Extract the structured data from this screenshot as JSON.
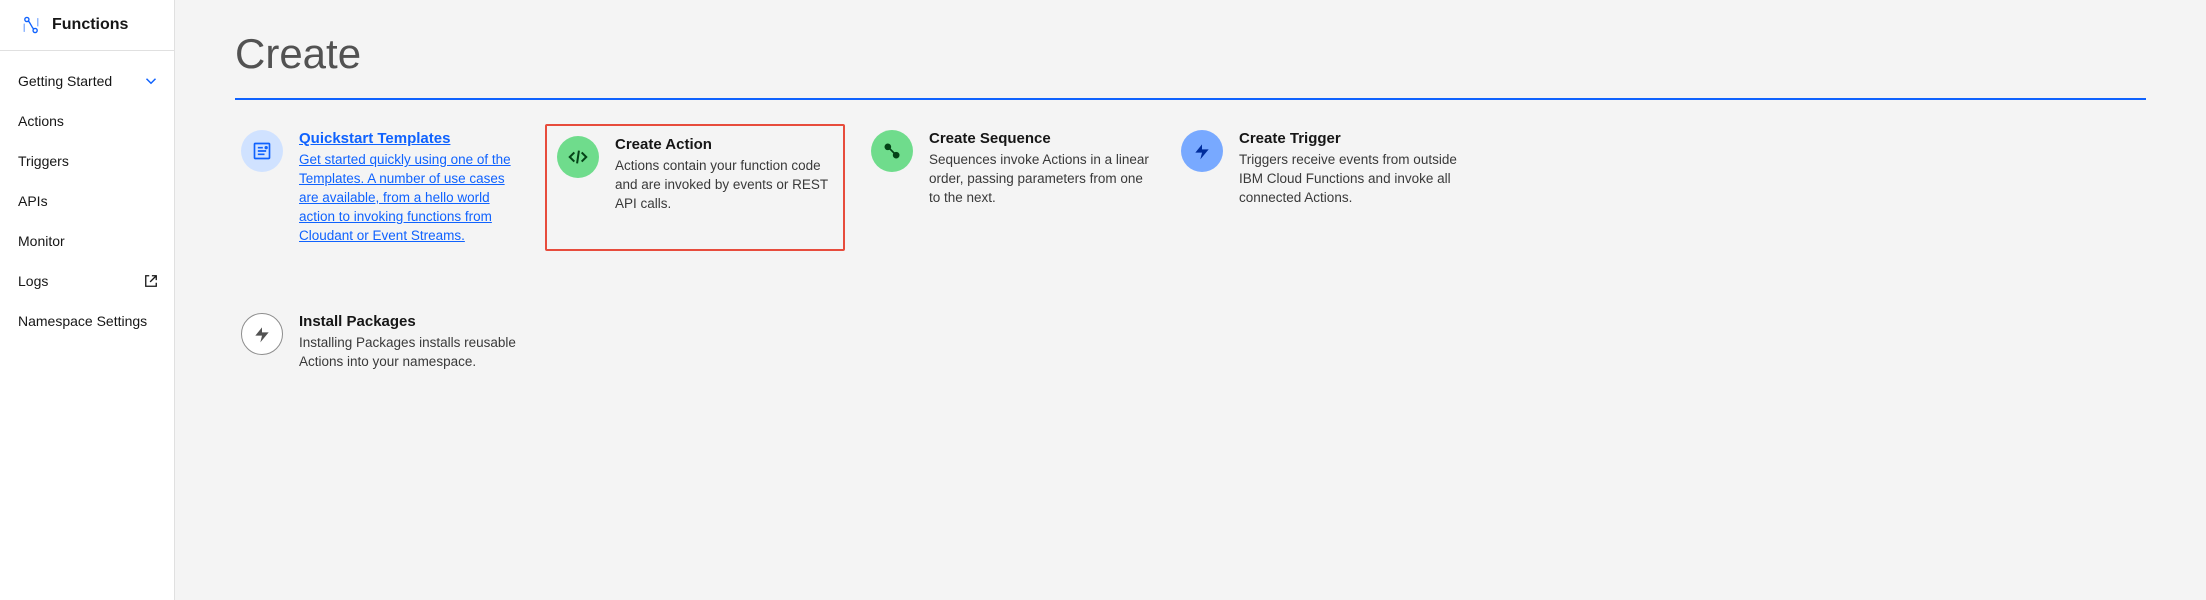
{
  "sidebar": {
    "title": "Functions",
    "items": [
      {
        "label": "Getting Started",
        "chevron": true
      },
      {
        "label": "Actions"
      },
      {
        "label": "Triggers"
      },
      {
        "label": "APIs"
      },
      {
        "label": "Monitor"
      },
      {
        "label": "Logs",
        "external": true
      },
      {
        "label": "Namespace Settings"
      }
    ]
  },
  "main": {
    "title": "Create",
    "cards": {
      "quickstart": {
        "title": "Quickstart Templates",
        "desc": "Get started quickly using one of the Templates. A number of use cases are available, from a hello world action to invoking functions from Cloudant or Event Streams."
      },
      "action": {
        "title": "Create Action",
        "desc": "Actions contain your function code and are invoked by events or REST API calls."
      },
      "sequence": {
        "title": "Create Sequence",
        "desc": "Sequences invoke Actions in a linear order, passing parameters from one to the next."
      },
      "trigger": {
        "title": "Create Trigger",
        "desc": "Triggers receive events from outside IBM Cloud Functions and invoke all connected Actions."
      },
      "packages": {
        "title": "Install Packages",
        "desc": "Installing Packages installs reusable Actions into your namespace."
      }
    }
  }
}
